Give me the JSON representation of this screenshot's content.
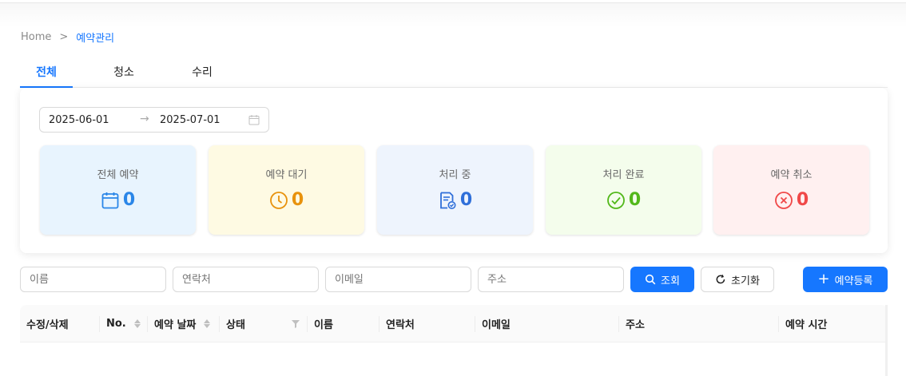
{
  "breadcrumb": {
    "home": "Home",
    "separator": ">",
    "current": "예약관리"
  },
  "tabs": [
    {
      "label": "전체",
      "active": true
    },
    {
      "label": "청소",
      "active": false
    },
    {
      "label": "수리",
      "active": false
    }
  ],
  "date_range": {
    "start": "2025-06-01",
    "end": "2025-07-01",
    "icon": "calendar-icon"
  },
  "stats": [
    {
      "label": "전체 예약",
      "value": "0",
      "color": "#1677ff",
      "bg": "#e8f4fe",
      "icon": "calendar-icon"
    },
    {
      "label": "예약 대기",
      "value": "0",
      "color": "#e8920c",
      "bg": "#fefae3",
      "icon": "clock-icon"
    },
    {
      "label": "처리 중",
      "value": "0",
      "color": "#2f6fd9",
      "bg": "#eef4fd",
      "icon": "document-check-icon"
    },
    {
      "label": "처리 완료",
      "value": "0",
      "color": "#52b81a",
      "bg": "#f4fdec",
      "icon": "check-circle-icon"
    },
    {
      "label": "예약 취소",
      "value": "0",
      "color": "#f04848",
      "bg": "#fff0f0",
      "icon": "close-circle-icon"
    }
  ],
  "filters": {
    "name_placeholder": "이름",
    "phone_placeholder": "연락처",
    "email_placeholder": "이메일",
    "address_placeholder": "주소"
  },
  "buttons": {
    "search": "조회",
    "reset": "초기화",
    "register": "예약등록"
  },
  "table": {
    "columns": [
      "수정/삭제",
      "No.",
      "예약 날짜",
      "상태",
      "이름",
      "연락처",
      "이메일",
      "주소",
      "예약 시간"
    ],
    "rows": []
  }
}
